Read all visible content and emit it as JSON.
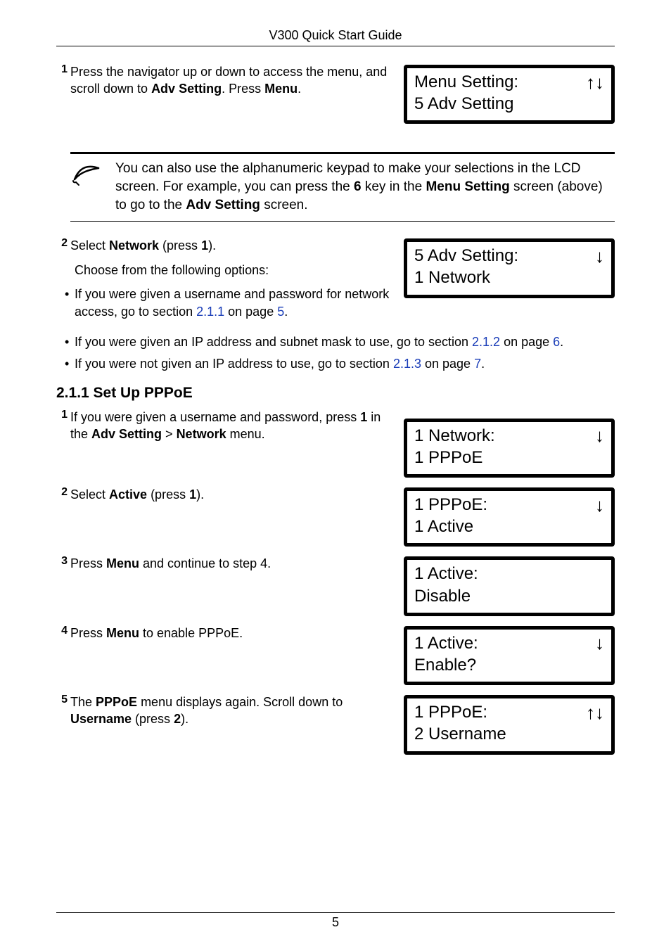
{
  "header": {
    "title": "V300 Quick Start Guide"
  },
  "step1": {
    "num": "1",
    "text_before": "Press the navigator up or down to access the menu, and scroll down to ",
    "bold1": "Adv Setting",
    "text_mid1": ". Press ",
    "bold2": "Menu",
    "text_after": "."
  },
  "lcd1": {
    "line1": "Menu Setting:",
    "arrow": "↑↓",
    "line2": "5 Adv Setting"
  },
  "note": {
    "text_a": "You can also use the alphanumeric keypad to make your selections in the LCD screen. For example, you can press the ",
    "bold1": "6",
    "text_b": " key in the ",
    "bold2": "Menu Setting",
    "text_c": " screen (above) to go to the ",
    "bold3": "Adv Setting",
    "text_d": " screen."
  },
  "step2": {
    "num": "2",
    "text_a": "Select ",
    "bold1": "Network",
    "text_b": " (press ",
    "bold2": "1",
    "text_c": ").",
    "choose": "Choose from the following options:"
  },
  "lcd2": {
    "line1": "5 Adv Setting:",
    "arrow": "↓",
    "line2": "1 Network"
  },
  "bullet1": {
    "text_a": "If you were given a username and password for network access, go to section ",
    "link1": "2.1.1",
    "text_b": " on page ",
    "link2": "5",
    "text_c": "."
  },
  "bullet2": {
    "text_a": "If you were given an IP address and subnet mask to use, go to section ",
    "link1": "2.1.2",
    "text_b": " on page ",
    "link2": "6",
    "text_c": "."
  },
  "bullet3": {
    "text_a": "If you were not given an IP address to use, go to section ",
    "link1": "2.1.3",
    "text_b": " on page ",
    "link2": "7",
    "text_c": "."
  },
  "section": {
    "heading": "2.1.1 Set Up PPPoE"
  },
  "p_step1": {
    "num": "1",
    "text_a": "If you were given a username and password, press ",
    "bold1": "1",
    "text_b": " in the ",
    "bold2": "Adv Setting",
    "text_c": " > ",
    "bold3": "Network",
    "text_d": " menu."
  },
  "lcd_p1": {
    "line1": "1 Network:",
    "arrow": "↓",
    "line2": "1 PPPoE"
  },
  "p_step2": {
    "num": "2",
    "text_a": "Select ",
    "bold1": "Active",
    "text_b": " (press ",
    "bold2": "1",
    "text_c": ")."
  },
  "lcd_p2": {
    "line1": "1 PPPoE:",
    "arrow": "↓",
    "line2": "1 Active"
  },
  "p_step3": {
    "num": "3",
    "text_a": "Press ",
    "bold1": "Menu",
    "text_b": " and continue to step 4."
  },
  "lcd_p3": {
    "line1": "1 Active:",
    "arrow": "",
    "line2": "Disable"
  },
  "p_step4": {
    "num": "4",
    "text_a": "Press ",
    "bold1": "Menu",
    "text_b": " to enable PPPoE."
  },
  "lcd_p4": {
    "line1": "1 Active:",
    "arrow": "↓",
    "line2": "Enable?"
  },
  "p_step5": {
    "num": "5",
    "text_a": "The ",
    "bold1": "PPPoE",
    "text_b": " menu displays again. Scroll down to ",
    "bold2": "Username",
    "text_c": " (press ",
    "bold3": "2",
    "text_d": ")."
  },
  "lcd_p5": {
    "line1": "1 PPPoE:",
    "arrow": "↑↓",
    "line2": "2 Username"
  },
  "footer": {
    "page": "5"
  }
}
